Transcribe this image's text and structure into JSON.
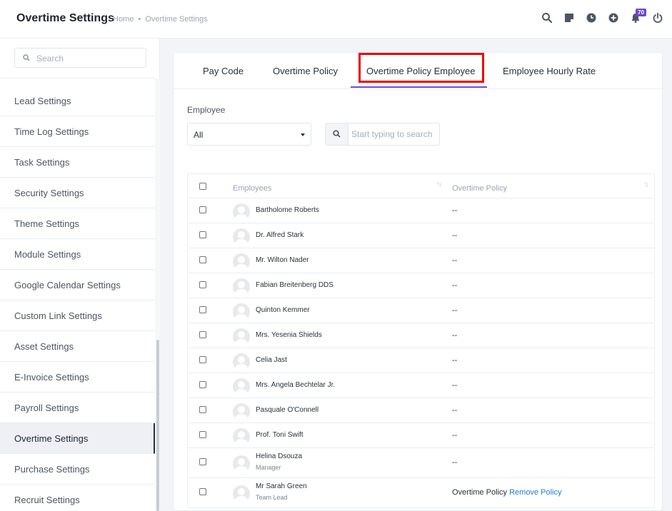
{
  "header": {
    "title": "Overtime Settings",
    "breadcrumb_home": "Home",
    "breadcrumb_sep": "•",
    "breadcrumb_current": "Overtime Settings",
    "notification_count": "70"
  },
  "sidebar": {
    "search_placeholder": "Search",
    "items": [
      {
        "label": "Lead Settings"
      },
      {
        "label": "Time Log Settings"
      },
      {
        "label": "Task Settings"
      },
      {
        "label": "Security Settings"
      },
      {
        "label": "Theme Settings"
      },
      {
        "label": "Module Settings"
      },
      {
        "label": "Google Calendar Settings"
      },
      {
        "label": "Custom Link Settings"
      },
      {
        "label": "Asset Settings"
      },
      {
        "label": "E-Invoice Settings"
      },
      {
        "label": "Payroll Settings"
      },
      {
        "label": "Overtime Settings"
      },
      {
        "label": "Purchase Settings"
      },
      {
        "label": "Recruit Settings"
      }
    ],
    "active_item": "Overtime Settings"
  },
  "tabs": [
    {
      "label": "Pay Code"
    },
    {
      "label": "Overtime Policy"
    },
    {
      "label": "Overtime Policy Employee"
    },
    {
      "label": "Employee Hourly Rate"
    }
  ],
  "active_tab": "Overtime Policy Employee",
  "filters": {
    "employee_label": "Employee",
    "employee_selected": "All",
    "search_placeholder": "Start typing to search"
  },
  "table": {
    "columns": [
      "Employees",
      "Overtime Policy"
    ],
    "rows": [
      {
        "name": "Bartholome Roberts",
        "designation": "",
        "policy": "--"
      },
      {
        "name": "Dr. Alfred Stark",
        "designation": "",
        "policy": "--"
      },
      {
        "name": "Mr. Wilton Nader",
        "designation": "",
        "policy": "--"
      },
      {
        "name": "Fabian Breitenberg DDS",
        "designation": "",
        "policy": "--"
      },
      {
        "name": "Quinton Kemmer",
        "designation": "",
        "policy": "--"
      },
      {
        "name": "Mrs. Yesenia Shields",
        "designation": "",
        "policy": "--"
      },
      {
        "name": "Celia Jast",
        "designation": "",
        "policy": "--"
      },
      {
        "name": "Mrs. Angela Bechtelar Jr.",
        "designation": "",
        "policy": "--"
      },
      {
        "name": "Pasquale O'Connell",
        "designation": "",
        "policy": "--"
      },
      {
        "name": "Prof. Toni Swift",
        "designation": "",
        "policy": "--"
      },
      {
        "name": "Helina Dsouza",
        "designation": "Manager",
        "policy": "--"
      },
      {
        "name": "Mr Sarah Green",
        "designation": "Team Lead",
        "policy": "Overtime Policy",
        "action": "Remove Policy"
      }
    ]
  },
  "colors": {
    "accent": "#6c4bcc",
    "highlight": "#ee0000",
    "link": "#1e7cd8"
  }
}
